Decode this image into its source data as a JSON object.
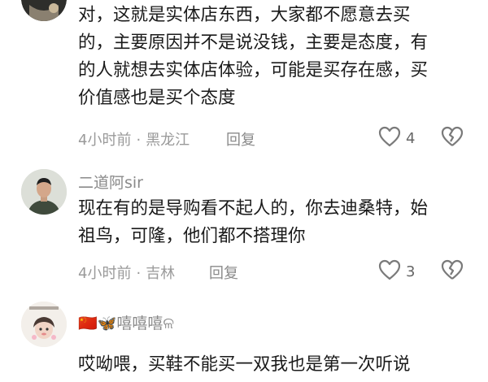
{
  "comments": [
    {
      "lines": [
        "对，这就是实体店东西，大家都不愿意去买",
        "的，主要原因并不是说没钱，主要是态度，有",
        "的人就想去实体店体验，可能是买存在感，买",
        "价值感也是买个态度"
      ],
      "time": "4小时前",
      "location": "黑龙江",
      "reply_label": "回复",
      "likes": "4"
    },
    {
      "username": "二道阿sir",
      "lines": [
        "现在有的是导购看不起人的，你去迪桑特，始",
        "祖鸟，可隆，他们都不搭理你"
      ],
      "time": "4小时前",
      "location": "吉林",
      "reply_label": "回复",
      "likes": "3"
    },
    {
      "username": "🇨🇳🦋嘻嘻嘻ଳ",
      "lines": [
        "哎呦喂，买鞋不能买一双我也是第一次听说"
      ]
    }
  ],
  "separator": "·",
  "icons": {
    "like": "heart-outline-icon",
    "dislike": "broken-heart-icon"
  },
  "colors": {
    "text": "#1a1a1a",
    "muted": "#8a8a8a"
  }
}
